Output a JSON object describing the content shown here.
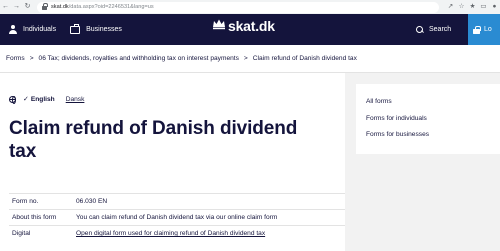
{
  "browser": {
    "url_host": "skat.dk",
    "url_path": "/data.aspx?oid=2246531&lang=us"
  },
  "header": {
    "individuals": "Individuals",
    "businesses": "Businesses",
    "logo": "skat.dk",
    "search": "Search",
    "login": "Lo"
  },
  "breadcrumb": {
    "items": [
      "Forms",
      "06 Tax; dividends, royalties and withholding tax on interest payments",
      "Claim refund of Danish dividend tax"
    ],
    "separator": ">"
  },
  "language": {
    "current": "English",
    "other": "Dansk"
  },
  "page": {
    "title": "Claim refund of Danish dividend tax"
  },
  "info": {
    "rows": [
      {
        "key": "Form no.",
        "value": "06.030 EN"
      },
      {
        "key": "About this form",
        "value": "You can claim refund of Danish dividend tax via our online claim form"
      },
      {
        "key": "Digital",
        "value": "Open digital form used for claiming refund of Danish dividend tax"
      }
    ]
  },
  "sidebar": {
    "links": [
      "All forms",
      "Forms for individuals",
      "Forms for businesses"
    ]
  },
  "colors": {
    "navy": "#14143c",
    "login_blue": "#2a8bd2",
    "page_bg": "#f2f2f2"
  }
}
